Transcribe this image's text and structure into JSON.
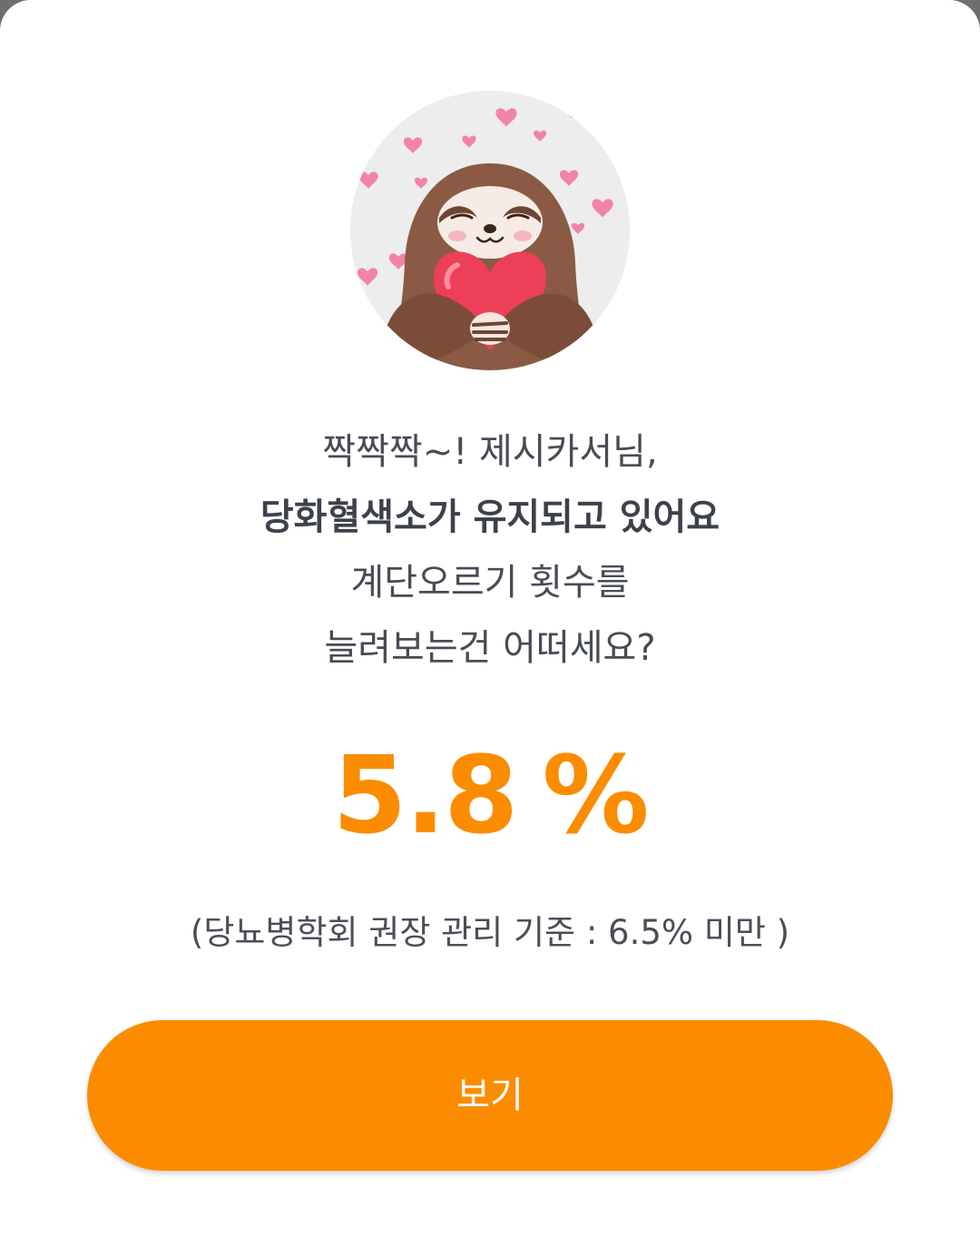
{
  "message": {
    "line1": "짝짝짝~! 제시카서님,",
    "line2": "당화혈색소가 유지되고 있어요",
    "line3": "계단오르기 횟수를",
    "line4": "늘려보는건 어떠세요?"
  },
  "result": {
    "value": "5.8",
    "unit": "%"
  },
  "criterion": "(당뇨병학회 권장 관리 기준 : 6.5% 미만 )",
  "button": {
    "label": "보기"
  },
  "colors": {
    "accent": "#fb8c00",
    "text": "#474b55",
    "avatar_bg": "#ededed"
  },
  "icons": {
    "avatar": "sloth-holding-heart-illustration"
  }
}
